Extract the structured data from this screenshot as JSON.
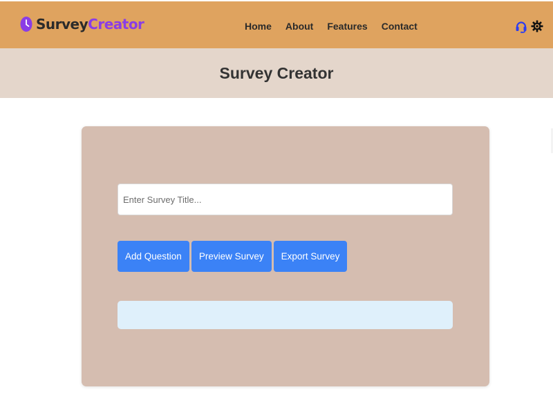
{
  "app": {
    "logo_word1": "Survey",
    "logo_word2": "Creator",
    "accent_purple": "#8a3de6",
    "nav_bg": "#dfa35f"
  },
  "nav": {
    "links": [
      "Home",
      "About",
      "Features",
      "Contact"
    ],
    "icons": [
      "headset-icon",
      "gear-icon"
    ]
  },
  "header": {
    "title": "Survey Creator"
  },
  "form": {
    "title_placeholder": "Enter Survey Title...",
    "title_value": "",
    "buttons": [
      "Add Question",
      "Preview Survey",
      "Export Survey"
    ],
    "button_color": "#3b82f6",
    "questions_area_color": "#dff0fb"
  }
}
